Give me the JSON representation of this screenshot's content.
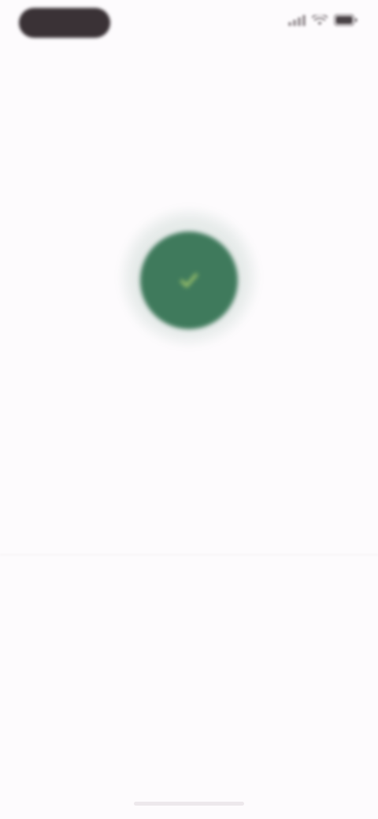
{
  "status_bar": {
    "time": "",
    "icons": [
      "signal-icon",
      "wifi-icon",
      "battery-icon"
    ]
  },
  "hero": {
    "icon": "check-icon",
    "badge_color": "#3f7a5c"
  },
  "content": {
    "title": "",
    "subtitle": ""
  },
  "footer": {
    "link_label": ""
  },
  "colors": {
    "background": "#fdfbfd",
    "accent": "#3f7a5c",
    "title_text": "#2f2a2d",
    "secondary_text": "#8d868a"
  }
}
